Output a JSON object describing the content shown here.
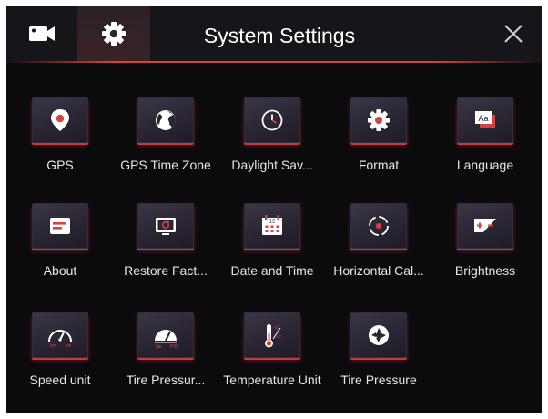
{
  "header": {
    "title": "System Settings",
    "tabs": [
      {
        "icon": "camera-icon"
      },
      {
        "icon": "gear-icon"
      }
    ],
    "close_icon": "close-icon"
  },
  "theme": {
    "accent": "#d6423f",
    "background": "#0b0b0d",
    "tile": "#2f2a38"
  },
  "items": [
    {
      "label": "GPS",
      "icon": "location-pin-icon"
    },
    {
      "label": "GPS Time Zone",
      "icon": "globe-icon"
    },
    {
      "label": "Daylight Sav...",
      "icon": "clock-icon"
    },
    {
      "label": "Format",
      "icon": "gear-format-icon"
    },
    {
      "label": "Language",
      "icon": "language-icon"
    },
    {
      "label": "About",
      "icon": "info-card-icon"
    },
    {
      "label": "Restore Fact...",
      "icon": "restore-icon"
    },
    {
      "label": "Date and Time",
      "icon": "calendar-icon"
    },
    {
      "label": "Horizontal Cal...",
      "icon": "crosshair-icon"
    },
    {
      "label": "Brightness",
      "icon": "brightness-icon"
    },
    {
      "label": "Speed unit",
      "icon": "speedometer-icon"
    },
    {
      "label": "Tire Pressur...",
      "icon": "pressure-gauge-icon"
    },
    {
      "label": "Temperature Unit",
      "icon": "thermometer-icon"
    },
    {
      "label": "Tire Pressure",
      "icon": "tire-icon"
    }
  ],
  "icon_text": {
    "language_sample": "Aa",
    "calendar_day": "12",
    "speed_unit_left": "km",
    "speed_unit_right": "mi",
    "pressure_unit_left": "bar",
    "pressure_unit_right": "PSI",
    "temp_c": "°C",
    "temp_f": "°F"
  }
}
